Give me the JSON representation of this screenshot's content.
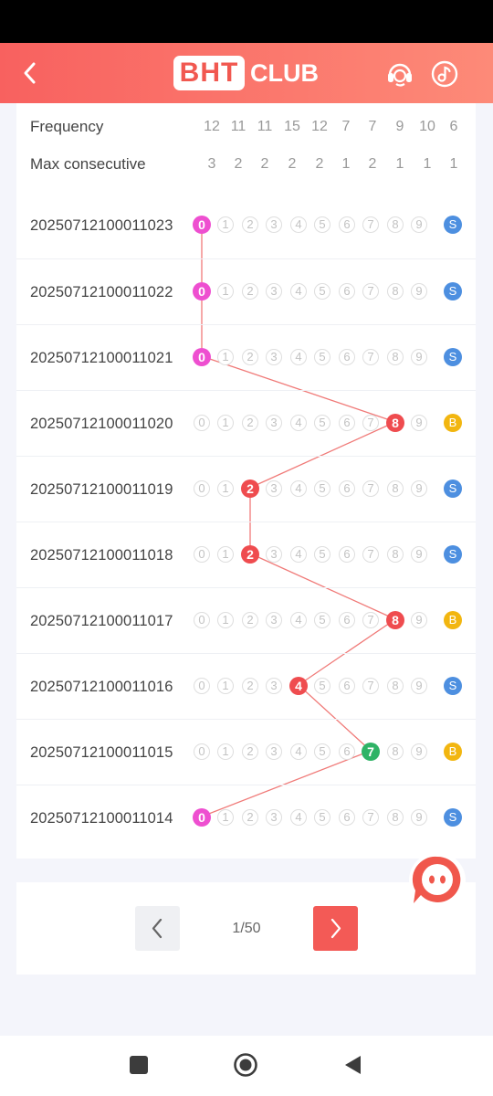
{
  "app": {
    "logo_box": "BHT",
    "logo_text": "CLUB"
  },
  "colors": {
    "accent": "#f35a56",
    "zero_ball": "#ee4fd0",
    "red_ball": "#ef4c4f",
    "green_ball": "#2fb366",
    "small_badge": "#4d8fe0",
    "big_badge": "#f2b610"
  },
  "stats": {
    "frequency_label": "Frequency",
    "frequency": [
      "12",
      "11",
      "11",
      "15",
      "12",
      "7",
      "7",
      "9",
      "10",
      "6"
    ],
    "max_consecutive_label": "Max consecutive",
    "max_consecutive": [
      "3",
      "2",
      "2",
      "2",
      "2",
      "1",
      "2",
      "1",
      "1",
      "1"
    ]
  },
  "digits": [
    "0",
    "1",
    "2",
    "3",
    "4",
    "5",
    "6",
    "7",
    "8",
    "9"
  ],
  "draws": [
    {
      "issue": "20250712100011023",
      "number": 0,
      "size": "S"
    },
    {
      "issue": "20250712100011022",
      "number": 0,
      "size": "S"
    },
    {
      "issue": "20250712100011021",
      "number": 0,
      "size": "S"
    },
    {
      "issue": "20250712100011020",
      "number": 8,
      "size": "B"
    },
    {
      "issue": "20250712100011019",
      "number": 2,
      "size": "S"
    },
    {
      "issue": "20250712100011018",
      "number": 2,
      "size": "S"
    },
    {
      "issue": "20250712100011017",
      "number": 8,
      "size": "B"
    },
    {
      "issue": "20250712100011016",
      "number": 4,
      "size": "S"
    },
    {
      "issue": "20250712100011015",
      "number": 7,
      "size": "B"
    },
    {
      "issue": "20250712100011014",
      "number": 0,
      "size": "S"
    }
  ],
  "pagination": {
    "text": "1/50"
  },
  "icons": {
    "back": "chevron-left-icon",
    "support": "headset-icon",
    "music": "music-note-icon",
    "chat": "chat-bubble-icon",
    "prev": "chevron-left-icon",
    "next": "chevron-right-icon"
  }
}
